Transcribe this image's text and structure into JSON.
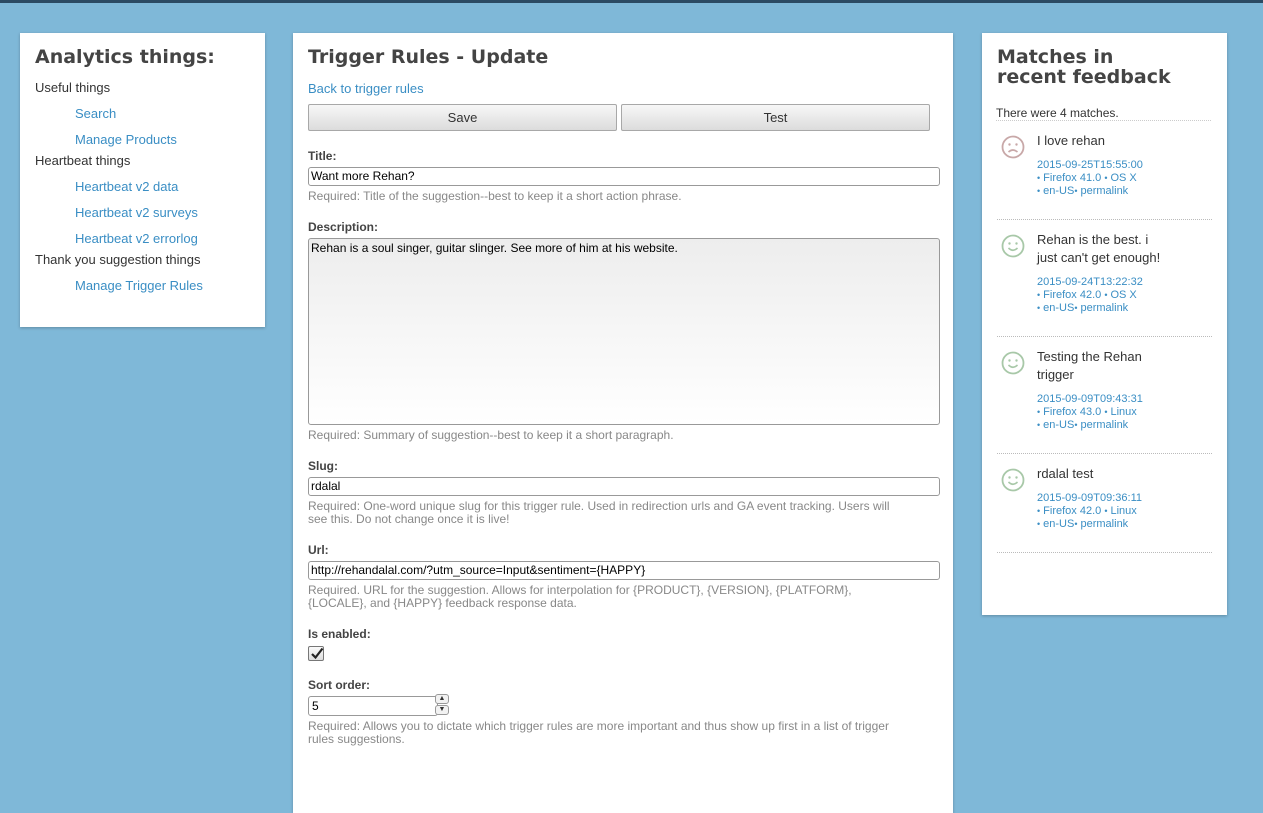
{
  "sidebar": {
    "title": "Analytics things:",
    "groups": [
      {
        "label": "Useful things",
        "links": [
          "Search",
          "Manage Products"
        ]
      },
      {
        "label": "Heartbeat things",
        "links": [
          "Heartbeat v2 data",
          "Heartbeat v2 surveys",
          "Heartbeat v2 errorlog"
        ]
      },
      {
        "label": "Thank you suggestion things",
        "links": [
          "Manage Trigger Rules"
        ]
      }
    ]
  },
  "main": {
    "title": "Trigger Rules - Update",
    "back_link": "Back to trigger rules",
    "save_label": "Save",
    "test_label": "Test",
    "title_field": {
      "label": "Title:",
      "value": "Want more Rehan?",
      "help": "Required: Title of the suggestion--best to keep it a short action phrase."
    },
    "description": {
      "label": "Description:",
      "value": "Rehan is a soul singer, guitar slinger. See more of him at his website.",
      "help": "Required: Summary of suggestion--best to keep it a short paragraph."
    },
    "slug": {
      "label": "Slug:",
      "value": "rdalal",
      "help": "Required: One-word unique slug for this trigger rule. Used in redirection urls and GA event tracking. Users will see this. Do not change once it is live!"
    },
    "url": {
      "label": "Url:",
      "value": "http://rehandalal.com/?utm_source=Input&sentiment={HAPPY}",
      "help": "Required. URL for the suggestion. Allows for interpolation for {PRODUCT}, {VERSION}, {PLATFORM}, {LOCALE}, and {HAPPY} feedback response data."
    },
    "is_enabled": {
      "label": "Is enabled:",
      "checked": true
    },
    "sort_order": {
      "label": "Sort order:",
      "value": "5",
      "help": "Required: Allows you to dictate which trigger rules are more important and thus show up first in a list of trigger rules suggestions."
    }
  },
  "matches": {
    "title": "Matches in recent feedback",
    "count_text": "There were 4 matches.",
    "items": [
      {
        "sentiment": "sad",
        "text": "I love rehan",
        "date": "2015-09-25T15:55:00",
        "product": "Firefox 41.0",
        "platform": "OS X",
        "locale": "en-US",
        "permalink": "permalink"
      },
      {
        "sentiment": "happy",
        "text": "Rehan is the best. i just can't get enough!",
        "date": "2015-09-24T13:22:32",
        "product": "Firefox 42.0",
        "platform": "OS X",
        "locale": "en-US",
        "permalink": "permalink"
      },
      {
        "sentiment": "happy",
        "text": "Testing the Rehan trigger",
        "date": "2015-09-09T09:43:31",
        "product": "Firefox 43.0",
        "platform": "Linux",
        "locale": "en-US",
        "permalink": "permalink"
      },
      {
        "sentiment": "happy",
        "text": "rdalal test",
        "date": "2015-09-09T09:36:11",
        "product": "Firefox 42.0",
        "platform": "Linux",
        "locale": "en-US",
        "permalink": "permalink"
      }
    ]
  },
  "colors": {
    "background": "#7fb8d8",
    "link": "#3a8ec4",
    "face": "#a8c8a8",
    "sad_face": "#c8a8a8"
  }
}
